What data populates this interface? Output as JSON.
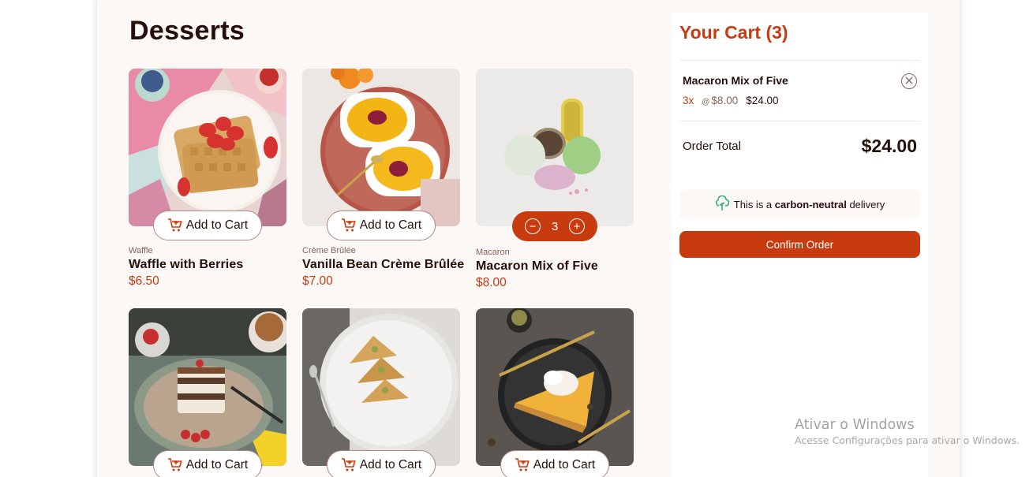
{
  "page": {
    "title": "Desserts"
  },
  "products": [
    {
      "category": "Waffle",
      "name": "Waffle with Berries",
      "price": "$6.50",
      "button": "Add to Cart"
    },
    {
      "category": "Crème Brûlée",
      "name": "Vanilla Bean Crème Brûlée",
      "price": "$7.00",
      "button": "Add to Cart"
    },
    {
      "category": "Macaron",
      "name": "Macaron Mix of Five",
      "price": "$8.00",
      "quantity": "3",
      "minus": "−",
      "plus": "+"
    },
    {
      "button": "Add to Cart"
    },
    {
      "button": "Add to Cart"
    },
    {
      "button": "Add to Cart"
    }
  ],
  "cart": {
    "title": "Your Cart (3)",
    "items": [
      {
        "name": "Macaron Mix of Five",
        "qty": "3x",
        "each_prefix": "@",
        "each": "$8.00",
        "total": "$24.00"
      }
    ],
    "order_total_label": "Order Total",
    "order_total": "$24.00",
    "carbon_prefix": "This is a",
    "carbon_bold": "carbon-neutral",
    "carbon_suffix": "delivery",
    "confirm": "Confirm Order"
  },
  "watermark": {
    "line1": "Ativar o Windows",
    "line2": "Acesse Configurações para ativar o Windows."
  },
  "colors": {
    "accent": "#c73b0f",
    "text": "#260f08",
    "muted": "#87635a",
    "bg": "#fcf8f6",
    "green": "#1ea575"
  }
}
